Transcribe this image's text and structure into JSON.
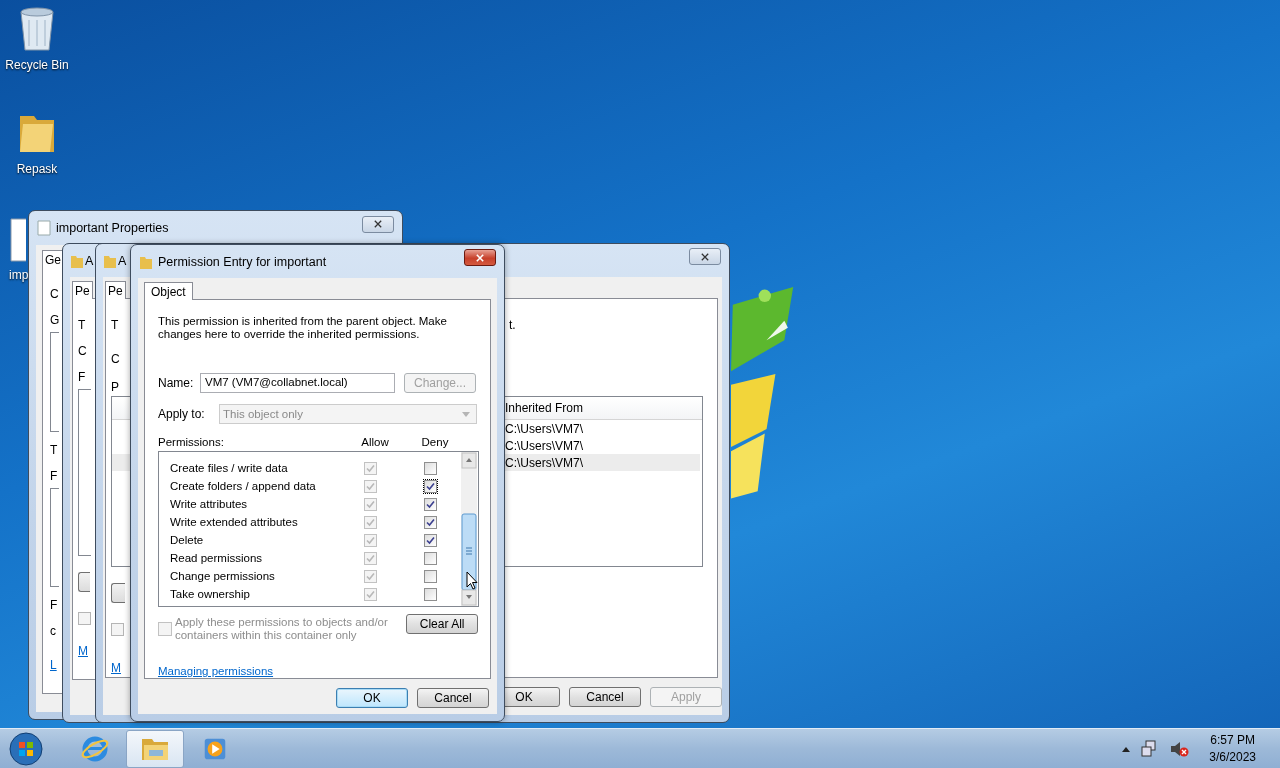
{
  "desktop_icons": [
    {
      "label": "Recycle Bin",
      "kind": "recycle-bin"
    },
    {
      "label": "Repask",
      "kind": "folder"
    },
    {
      "label": "imp",
      "kind": "document"
    }
  ],
  "properties_window": {
    "title": "important Properties",
    "tab": "Ge",
    "fragments": [
      {
        "kind": "text",
        "text": "C"
      },
      {
        "kind": "text",
        "text": "G"
      },
      {
        "kind": "list"
      },
      {
        "kind": "text",
        "text": "T"
      },
      {
        "kind": "text",
        "text": "F"
      },
      {
        "kind": "list"
      },
      {
        "kind": "text",
        "text": "F"
      },
      {
        "kind": "text",
        "text": "c"
      },
      {
        "kind": "link",
        "text": "L"
      }
    ]
  },
  "middle_window": {
    "title": "A",
    "tab": "Pe",
    "fragments": [
      {
        "kind": "text",
        "text": "T"
      },
      {
        "kind": "text",
        "text": "C"
      },
      {
        "kind": "text",
        "text": "F"
      },
      {
        "kind": "list"
      },
      {
        "kind": "button"
      },
      {
        "kind": "checkbox",
        "checked": false,
        "disabled": true
      },
      {
        "kind": "link",
        "text": "M"
      }
    ]
  },
  "security_window": {
    "title": "A",
    "tab": "Pe",
    "line_start": "T",
    "line_end": "t.",
    "label_1": "C",
    "label_2": "P",
    "list": {
      "column": "Inherited From",
      "rows": [
        {
          "inherited_from": "C:\\Users\\VM7\\",
          "selected": false
        },
        {
          "inherited_from": "C:\\Users\\VM7\\",
          "selected": false
        },
        {
          "inherited_from": "C:\\Users\\VM7\\",
          "selected": true
        }
      ]
    },
    "checkbox": {
      "checked": false,
      "disabled": true
    },
    "link": "M",
    "buttons": [
      {
        "label": "OK",
        "disabled": false
      },
      {
        "label": "Cancel",
        "disabled": false
      },
      {
        "label": "Apply",
        "disabled": true
      }
    ]
  },
  "dialog": {
    "title": "Permission Entry for important",
    "tab": "Object",
    "notice": "This permission is inherited from the parent object. Make changes here to override the inherited permissions.",
    "name_label": "Name:",
    "name_value": "VM7 (VM7@collabnet.local)",
    "change_button": {
      "label": "Change...",
      "disabled": true
    },
    "apply_to_label": "Apply to:",
    "apply_to": {
      "value": "This object only",
      "disabled": true
    },
    "permissions_label": "Permissions:",
    "columns": [
      "Allow",
      "Deny"
    ],
    "permissions": [
      {
        "name": "Create files / write data",
        "allow": true,
        "allow_disabled": true,
        "deny": false,
        "focused": false
      },
      {
        "name": "Create folders / append data",
        "allow": true,
        "allow_disabled": true,
        "deny": true,
        "focused": true
      },
      {
        "name": "Write attributes",
        "allow": true,
        "allow_disabled": true,
        "deny": true,
        "focused": false
      },
      {
        "name": "Write extended attributes",
        "allow": true,
        "allow_disabled": true,
        "deny": true,
        "focused": false
      },
      {
        "name": "Delete",
        "allow": true,
        "allow_disabled": true,
        "deny": true,
        "focused": false
      },
      {
        "name": "Read permissions",
        "allow": true,
        "allow_disabled": true,
        "deny": false,
        "focused": false
      },
      {
        "name": "Change permissions",
        "allow": true,
        "allow_disabled": true,
        "deny": false,
        "focused": false
      },
      {
        "name": "Take ownership",
        "allow": true,
        "allow_disabled": true,
        "deny": false,
        "focused": false
      }
    ],
    "apply_inside": {
      "label": "Apply these permissions to objects and/or containers within this container only",
      "checked": false,
      "disabled": true
    },
    "clear_all": "Clear All",
    "help_link": "Managing permissions",
    "buttons": [
      {
        "label": "OK",
        "default": true
      },
      {
        "label": "Cancel",
        "default": false
      }
    ]
  },
  "taskbar": {
    "items": [
      {
        "kind": "start",
        "selected": false
      },
      {
        "kind": "browser",
        "selected": false
      },
      {
        "kind": "folder",
        "selected": true
      },
      {
        "kind": "media",
        "selected": false
      }
    ],
    "volume_muted": true,
    "time": "6:57 PM",
    "date": "3/6/2023"
  }
}
